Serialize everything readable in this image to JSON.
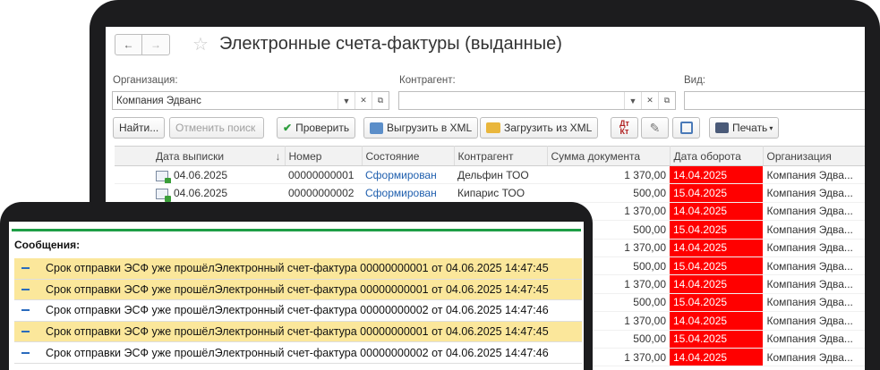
{
  "window": {
    "title": "Электронные счета-фактуры (выданные)"
  },
  "nav": {
    "back": "←",
    "forward": "→"
  },
  "filters": {
    "org_label": "Организация:",
    "org_value": "Компания Эдванс",
    "counterparty_label": "Контрагент:",
    "counterparty_value": "",
    "kind_label": "Вид:",
    "kind_value": ""
  },
  "toolbar": {
    "find": "Найти...",
    "cancel_search": "Отменить поиск",
    "check": "Проверить",
    "export_xml": "Выгрузить в XML",
    "import_xml": "Загрузить из XML",
    "print": "Печать"
  },
  "table": {
    "columns": [
      "Дата выписки",
      "Номер",
      "Состояние",
      "Контрагент",
      "Сумма документа",
      "Дата оборота",
      "Организация"
    ],
    "rows": [
      {
        "date": "04.06.2025",
        "number": "00000000001",
        "state": "Сформирован",
        "counterparty": "Дельфин ТОО",
        "amount": "1 370,00",
        "turnover": "14.04.2025",
        "org": "Компания Эдва..."
      },
      {
        "date": "04.06.2025",
        "number": "00000000002",
        "state": "Сформирован",
        "counterparty": "Кипарис ТОО",
        "amount": "500,00",
        "turnover": "15.04.2025",
        "org": "Компания Эдва..."
      },
      {
        "amount": "1 370,00",
        "turnover": "14.04.2025",
        "org": "Компания Эдва..."
      },
      {
        "amount": "500,00",
        "turnover": "15.04.2025",
        "org": "Компания Эдва..."
      },
      {
        "amount": "1 370,00",
        "turnover": "14.04.2025",
        "org": "Компания Эдва..."
      },
      {
        "amount": "500,00",
        "turnover": "15.04.2025",
        "org": "Компания Эдва..."
      },
      {
        "amount": "1 370,00",
        "turnover": "14.04.2025",
        "org": "Компания Эдва..."
      },
      {
        "amount": "500,00",
        "turnover": "15.04.2025",
        "org": "Компания Эдва..."
      },
      {
        "amount": "1 370,00",
        "turnover": "14.04.2025",
        "org": "Компания Эдва..."
      },
      {
        "amount": "500,00",
        "turnover": "15.04.2025",
        "org": "Компания Эдва..."
      },
      {
        "amount": "1 370,00",
        "turnover": "14.04.2025",
        "org": "Компания Эдва..."
      }
    ]
  },
  "messages": {
    "title": "Сообщения:",
    "items": [
      "Срок отправки ЭСФ уже прошёлЭлектронный счет-фактура 00000000001 от 04.06.2025 14:47:45",
      "Срок отправки ЭСФ уже прошёлЭлектронный счет-фактура 00000000001 от 04.06.2025 14:47:45",
      "Срок отправки ЭСФ уже прошёлЭлектронный счет-фактура 00000000002 от 04.06.2025 14:47:46",
      "Срок отправки ЭСФ уже прошёлЭлектронный счет-фактура 00000000001 от 04.06.2025 14:47:45",
      "Срок отправки ЭСФ уже прошёлЭлектронный счет-фактура 00000000002 от 04.06.2025 14:47:46"
    ]
  },
  "colors": {
    "overdue": "#ff0000",
    "highlight": "#fbe79b",
    "accent_green": "#1e9e46",
    "link": "#1f5fae"
  }
}
